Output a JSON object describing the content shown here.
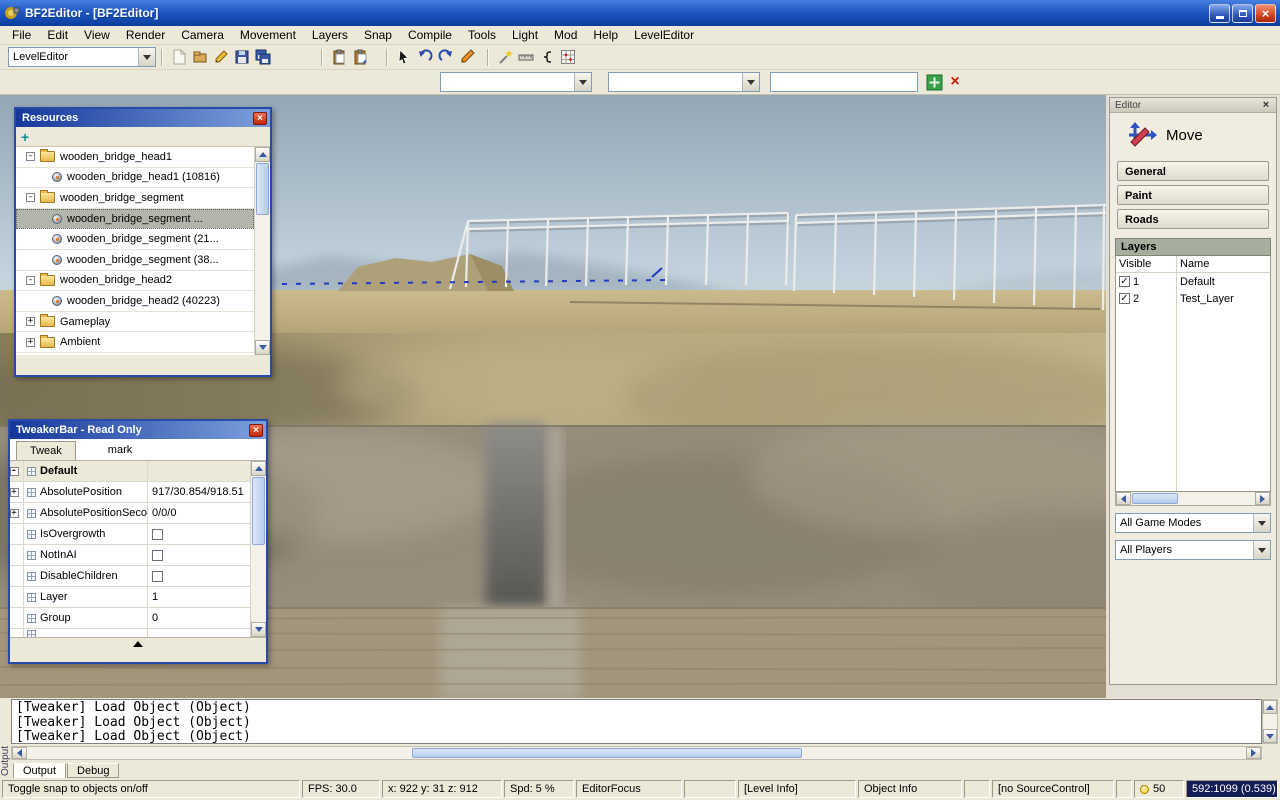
{
  "window": {
    "title": "BF2Editor - [BF2Editor]"
  },
  "menu": {
    "items": [
      "File",
      "Edit",
      "View",
      "Render",
      "Camera",
      "Movement",
      "Layers",
      "Snap",
      "Compile",
      "Tools",
      "Light",
      "Mod",
      "Help",
      "LevelEditor"
    ]
  },
  "toolbar": {
    "mode_combo": "LevelEditor",
    "icons": [
      "new-document",
      "open-package",
      "edit-package",
      "save",
      "save-all",
      "paste",
      "paste-special",
      "select-cursor",
      "rotate-left",
      "rotate-right",
      "pen",
      "magic-wand",
      "measure",
      "curve-tool",
      "terrain-grid",
      "add-selection",
      "clear-selection"
    ],
    "combo1_value": "",
    "combo2_value": "",
    "text_value": ""
  },
  "resources": {
    "title": "Resources",
    "items": [
      {
        "kind": "folder",
        "expand": "-",
        "label": "wooden_bridge_head1"
      },
      {
        "kind": "object",
        "label": "wooden_bridge_head1 (10816)"
      },
      {
        "kind": "folder",
        "expand": "-",
        "label": "wooden_bridge_segment"
      },
      {
        "kind": "object",
        "label": "wooden_bridge_segment ...",
        "selected": true
      },
      {
        "kind": "object",
        "label": "wooden_bridge_segment (21..."
      },
      {
        "kind": "object",
        "label": "wooden_bridge_segment (38..."
      },
      {
        "kind": "folder",
        "expand": "-",
        "label": "wooden_bridge_head2"
      },
      {
        "kind": "object",
        "label": "wooden_bridge_head2 (40223)"
      },
      {
        "kind": "folder",
        "expand": "+",
        "label": "Gameplay"
      },
      {
        "kind": "folder",
        "expand": "+",
        "label": "Ambient"
      }
    ]
  },
  "tweaker": {
    "title": "TweakerBar - Read Only",
    "tab_tweak": "Tweak",
    "tab_mark": "mark",
    "group_label": "Default",
    "rows": [
      {
        "expand": "+",
        "label": "AbsolutePosition",
        "value": "917/30.854/918.51"
      },
      {
        "expand": "+",
        "label": "AbsolutePositionSeco...",
        "value": "0/0/0"
      },
      {
        "label": "IsOvergrowth",
        "check": ""
      },
      {
        "label": "NotInAI",
        "check": ""
      },
      {
        "label": "DisableChildren",
        "check": ""
      },
      {
        "label": "Layer",
        "value": "1"
      },
      {
        "label": "Group",
        "value": "0"
      }
    ]
  },
  "editor": {
    "title": "Editor",
    "tool_label": "Move",
    "sections": [
      "General",
      "Paint",
      "Roads"
    ],
    "layers": {
      "header": "Layers",
      "columns": [
        "Visible",
        "Name"
      ],
      "rows": [
        {
          "check": "✓",
          "num": "1",
          "name": "Default"
        },
        {
          "check": "✓",
          "num": "2",
          "name": "Test_Layer"
        }
      ]
    },
    "game_modes_combo": "All Game Modes",
    "players_combo": "All Players"
  },
  "output": {
    "side_label": "Output",
    "lines": [
      "[Tweaker] Load Object (Object)",
      "[Tweaker] Load Object (Object)",
      "[Tweaker] Load Object (Object)"
    ],
    "tabs": [
      "Output",
      "Debug"
    ]
  },
  "status": {
    "cells": [
      "Toggle snap to objects on/off",
      "FPS: 30.0",
      "x: 922 y: 31 z: 912",
      "Spd: 5 %",
      "EditorFocus",
      "",
      "[Level Info]",
      "Object Info",
      "",
      "[no SourceControl]",
      ""
    ],
    "light_value": "50",
    "resolution": "592:1099 (0.539)"
  },
  "icons": {
    "close_glyph": "×",
    "add_glyph": "+",
    "cancel_glyph": "×"
  },
  "colors": {
    "titlebar_blue": "#2058C4",
    "panel_border_blue": "#2A4AA8",
    "selection_gray": "#B2B6AA",
    "accent_red": "#C02808"
  }
}
